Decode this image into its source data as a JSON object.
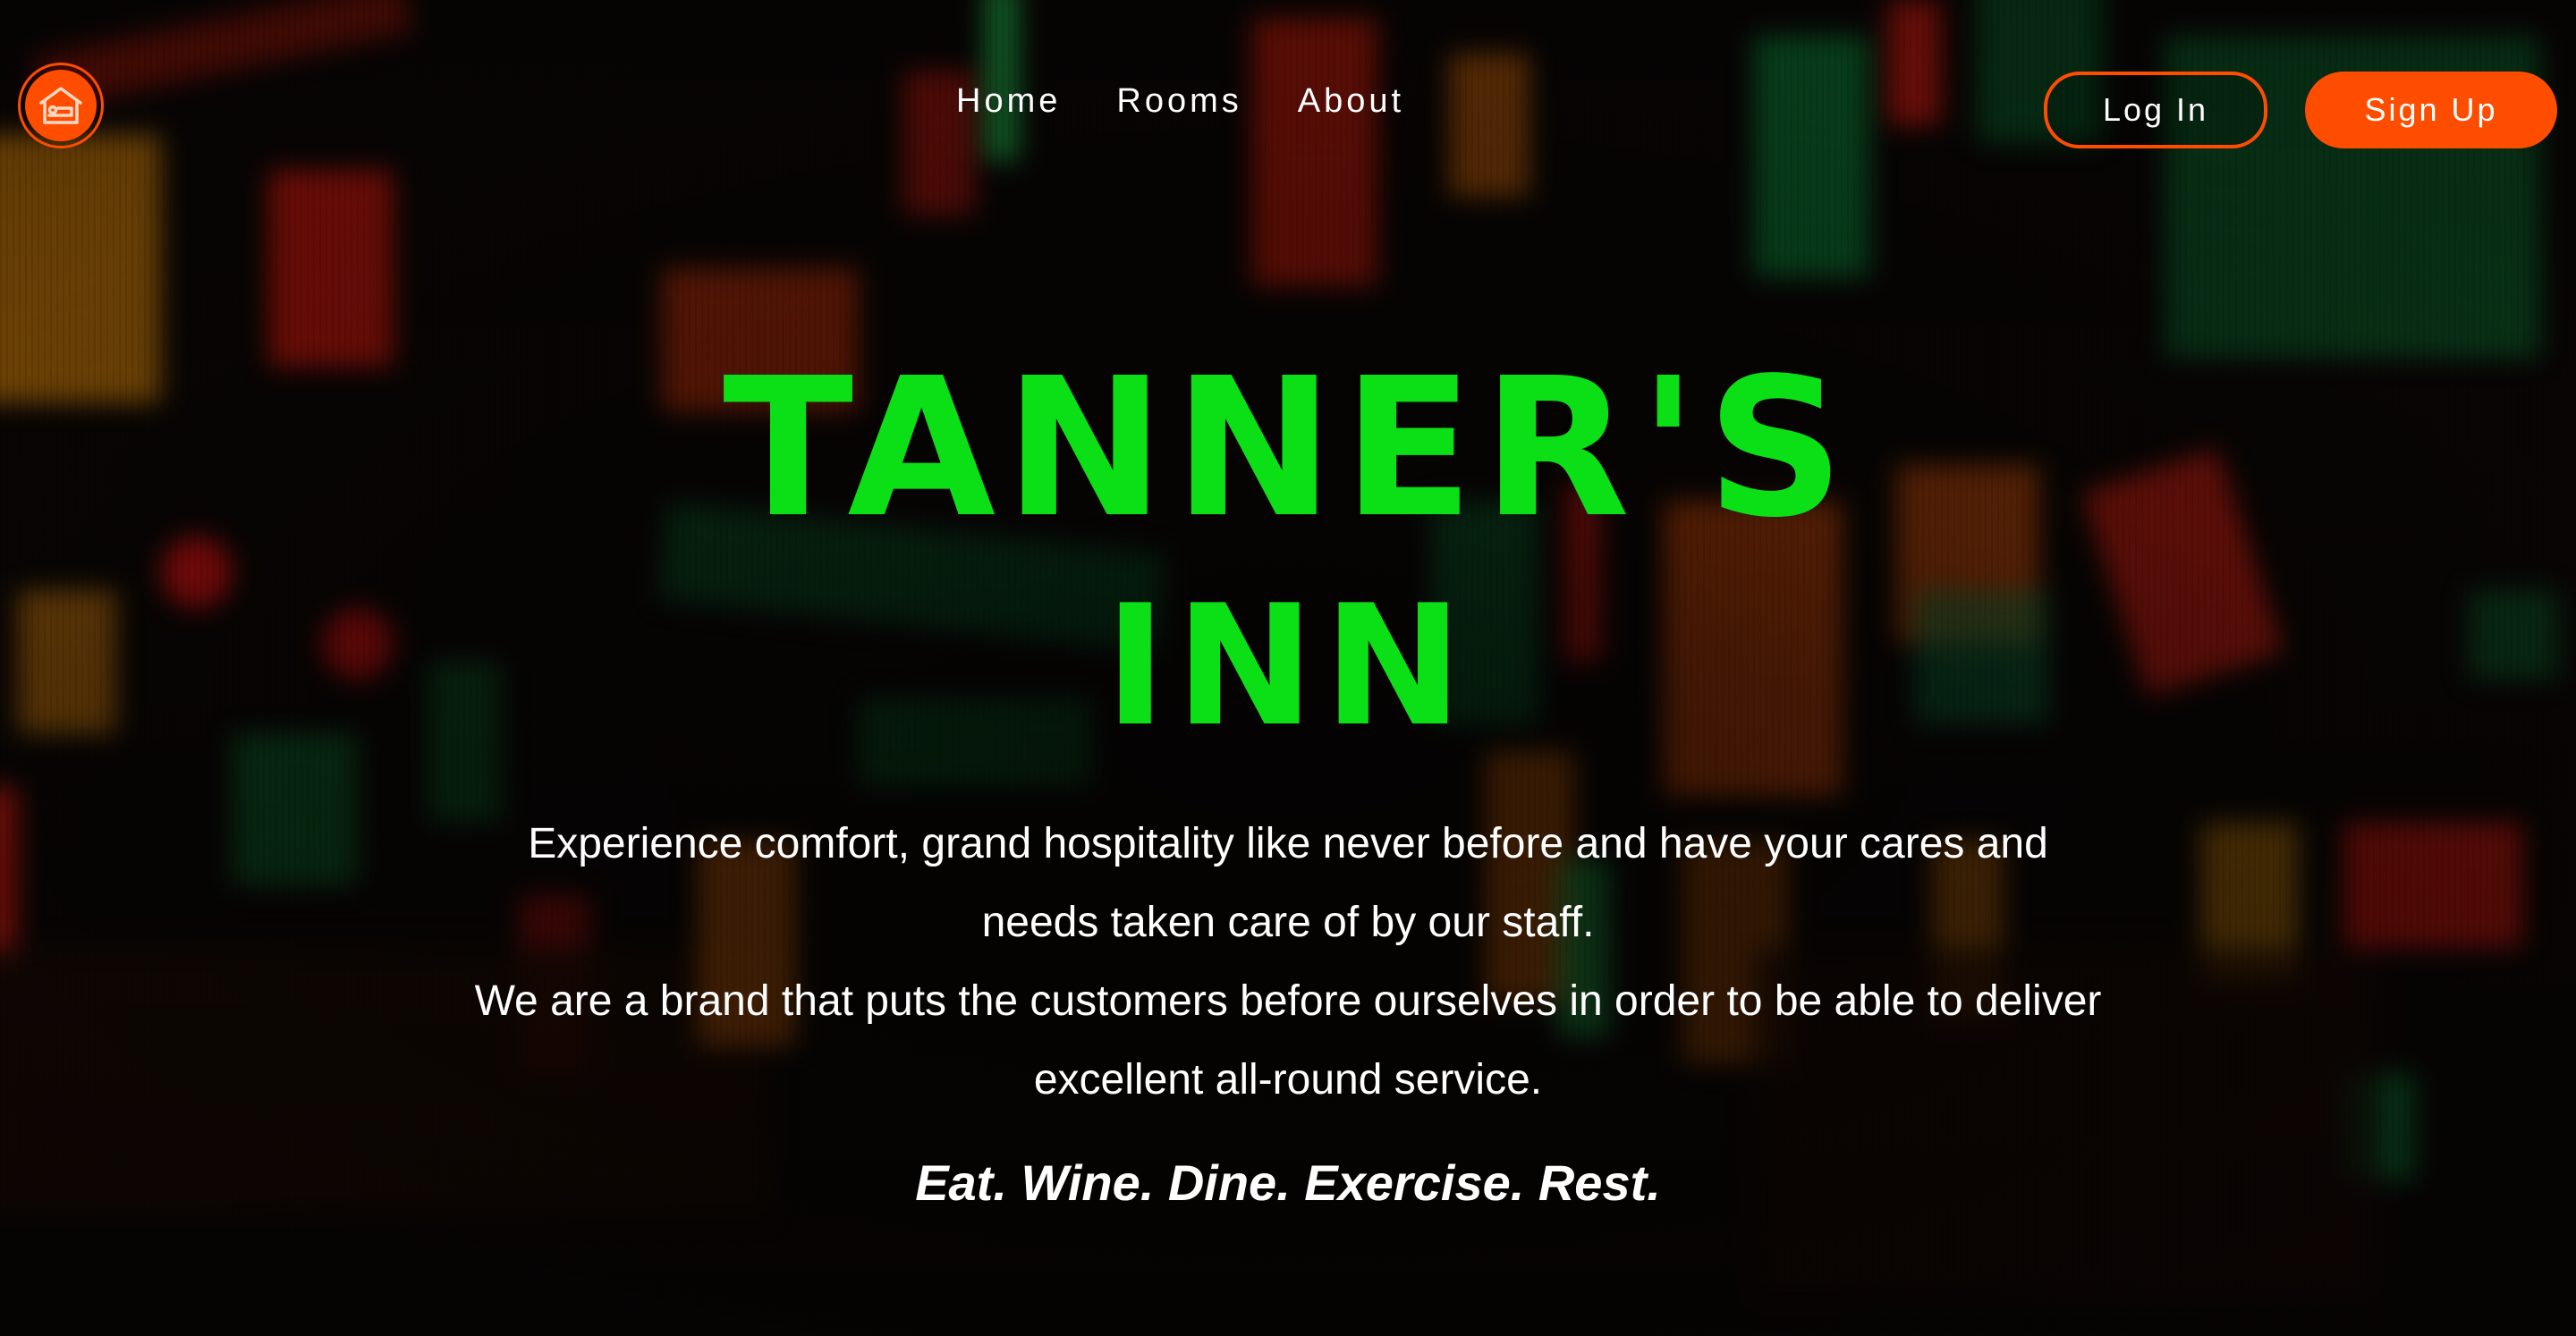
{
  "logo": {
    "icon": "hotel-bed-icon",
    "color": "#ff4d00"
  },
  "nav": {
    "items": [
      {
        "label": "Home"
      },
      {
        "label": "Rooms"
      },
      {
        "label": "About"
      }
    ]
  },
  "auth": {
    "login_label": "Log In",
    "signup_label": "Sign Up"
  },
  "hero": {
    "title_line1": "TANNER'S",
    "title_line2": "INN",
    "description_1": "Experience comfort, grand hospitality like never before and have your cares and needs taken care of by our staff.",
    "description_2": "We are a brand that puts the customers before ourselves in order to be able to deliver excellent all-round service.",
    "tagline": "Eat. Wine. Dine. Exercise. Rest."
  },
  "colors": {
    "accent": "#ff4d00",
    "title": "#0ae015",
    "text": "#ffffff"
  }
}
